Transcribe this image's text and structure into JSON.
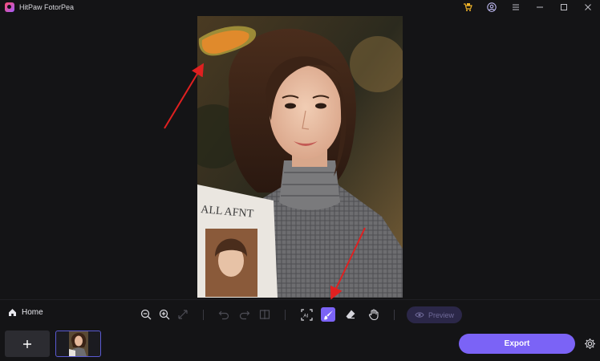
{
  "window": {
    "title": "HitPaw FotorPea",
    "icons": [
      "cart-icon",
      "account-icon",
      "menu-icon",
      "minimize-icon",
      "maximize-icon",
      "close-icon"
    ]
  },
  "toolbar": {
    "home_label": "Home",
    "preview_label": "Preview",
    "active_tool": "brush",
    "tools": [
      "zoom-out-icon",
      "zoom-in-icon",
      "fit-screen-icon",
      "undo-icon",
      "redo-icon",
      "compare-icon",
      "ai-select-icon",
      "brush-icon",
      "eraser-icon",
      "hand-icon",
      "eye-icon"
    ]
  },
  "magazine_text": "ALL AFNT",
  "footer": {
    "add_label": "+",
    "export_label": "Export"
  },
  "colors": {
    "accent": "#7b63f6",
    "background": "#141416",
    "brush_stroke": "#e08a2c",
    "annotation_arrow": "#e02020"
  }
}
